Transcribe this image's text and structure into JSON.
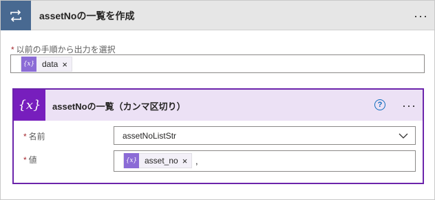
{
  "header": {
    "title": "assetNoの一覧を作成"
  },
  "from_field": {
    "label": "以前の手順から出力を選択",
    "required": "*",
    "token": {
      "icon_text": "{x}",
      "label": "data",
      "close": "×"
    }
  },
  "compose": {
    "icon_text": "{x}",
    "title": "assetNoの一覧（カンマ区切り）",
    "help": "?",
    "name_field": {
      "label": "名前",
      "required": "*",
      "value": "assetNoListStr"
    },
    "value_field": {
      "label": "値",
      "required": "*",
      "token": {
        "icon_text": "{x}",
        "label": "asset_no",
        "close": "×"
      },
      "trailing_text": ","
    }
  },
  "more": "···",
  "icons": {
    "loop": "loop-arrows-icon",
    "variable": "variable-braces-icon",
    "help": "question-circle-icon",
    "chevron": "chevron-down-icon"
  },
  "colors": {
    "loop_accent": "#486991",
    "variable_accent": "#771ebd",
    "token_icon": "#8b6bd6",
    "required": "#a4262c",
    "help": "#0f6cbd"
  }
}
